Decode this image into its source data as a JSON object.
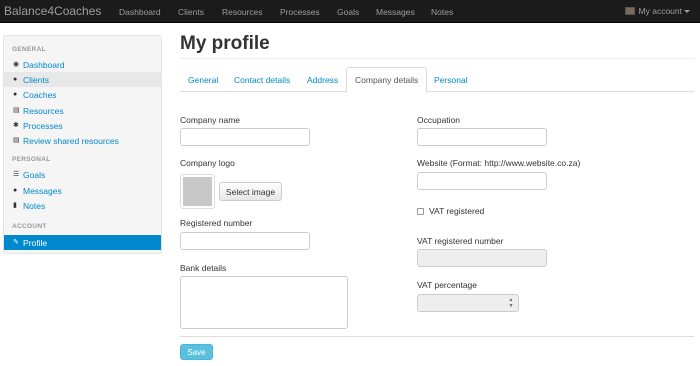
{
  "navbar": {
    "brand": "Balance4Coaches",
    "items": [
      "Dashboard",
      "Clients",
      "Resources",
      "Processes",
      "Goals",
      "Messages",
      "Notes"
    ],
    "account": "My account"
  },
  "sidebar": {
    "general_header": "GENERAL",
    "personal_header": "PERSONAL",
    "account_header": "ACCOUNT",
    "general_items": [
      "Dashboard",
      "Clients",
      "Coaches",
      "Resources",
      "Processes",
      "Review shared resources"
    ],
    "personal_items": [
      "Goals",
      "Messages",
      "Notes"
    ],
    "account_items": [
      "Profile"
    ]
  },
  "page": {
    "title": "My profile",
    "tabs": [
      "General",
      "Contact details",
      "Address",
      "Company details",
      "Personal"
    ],
    "active_tab": "Company details"
  },
  "form": {
    "company_name_label": "Company name",
    "company_name_value": "",
    "company_logo_label": "Company logo",
    "select_image_label": "Select image",
    "registered_number_label": "Registered number",
    "registered_number_value": "",
    "bank_details_label": "Bank details",
    "bank_details_value": "",
    "occupation_label": "Occupation",
    "occupation_value": "",
    "website_label": "Website (Format: http://www.website.co.za)",
    "website_value": "",
    "vat_registered_label": "VAT registered",
    "vat_registered_checked": false,
    "vat_number_label": "VAT registered number",
    "vat_number_value": "",
    "vat_percentage_label": "VAT percentage",
    "vat_percentage_value": "",
    "save_label": "Save"
  },
  "colors": {
    "navbar_bg": "#1b1b1b",
    "link": "#0088cc",
    "active_sidebar": "#0088cc",
    "save_button": "#5bc0de"
  }
}
